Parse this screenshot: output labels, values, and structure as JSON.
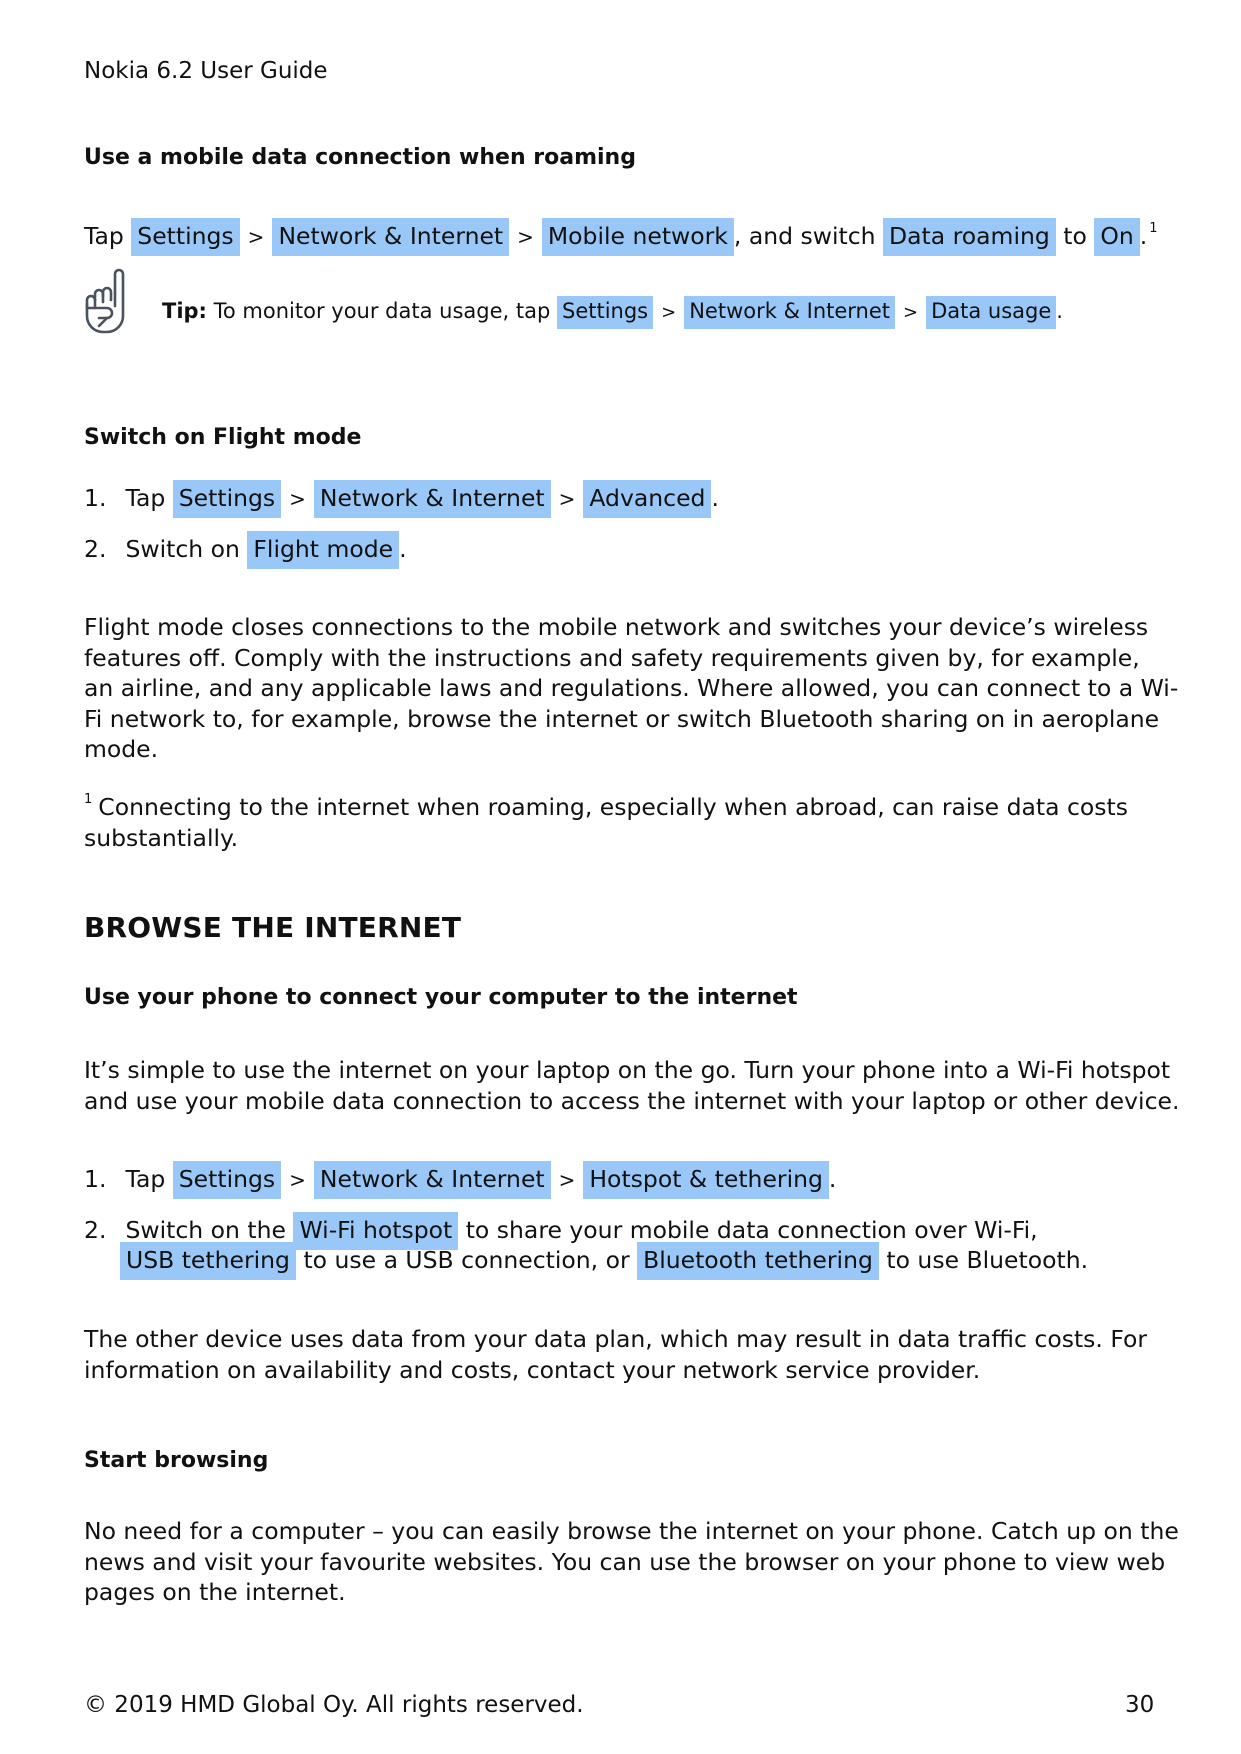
{
  "running_header": "Nokia 6.2 User Guide",
  "roaming": {
    "heading": "Use a mobile data connection when roaming",
    "instruction": {
      "prefix": "Tap",
      "path": [
        "Settings",
        "Network & Internet",
        "Mobile network"
      ],
      "middle": ", and switch",
      "toggle": "Data roaming",
      "to": "to",
      "state": "On",
      "suffix": ".",
      "footnote_ref": "1"
    },
    "tip": {
      "icon": "pointing-hand-icon",
      "label": "Tip:",
      "text": "To monitor your data usage, tap",
      "path": [
        "Settings",
        "Network & Internet",
        "Data usage"
      ],
      "suffix": "."
    }
  },
  "flight_mode": {
    "heading": "Switch on Flight mode",
    "steps": [
      {
        "number": "1.",
        "prefix": "Tap",
        "path": [
          "Settings",
          "Network & Internet",
          "Advanced"
        ],
        "suffix": "."
      },
      {
        "number": "2.",
        "prefix": "Switch on",
        "item": "Flight mode",
        "suffix": "."
      }
    ],
    "paragraph_lines": [
      "Flight mode closes connections to the mobile network and switches your device’s wireless",
      "features off.  Comply with the instructions and safety requirements given by, for example,",
      "an airline, and any applicable laws and regulations.  Where allowed, you can connect to a Wi-",
      "Fi network to, for example, browse the internet or switch Bluetooth sharing on in aeroplane",
      "mode."
    ],
    "footnote": {
      "marker": "1",
      "lines": [
        "Connecting to the internet when roaming, especially when abroad, can raise data costs",
        "substantially."
      ]
    }
  },
  "browse": {
    "heading": "BROWSE THE INTERNET",
    "connect": {
      "heading": "Use your phone to connect your computer to the internet",
      "paragraph_lines": [
        "It’s simple to use the internet on your laptop on the go.  Turn your phone into a Wi-Fi hotspot",
        "and use your mobile data connection to access the internet with your laptop or other device."
      ],
      "steps": [
        {
          "number": "1.",
          "prefix": "Tap",
          "path": [
            "Settings",
            "Network & Internet",
            "Hotspot & tethering"
          ],
          "suffix": "."
        },
        {
          "number": "2.",
          "prefix": "Switch on the",
          "item1": "Wi-Fi hotspot",
          "text1": "to share your mobile data connection over Wi-Fi,",
          "item2": "USB tethering",
          "text2": "to use a USB connection, or",
          "item3": "Bluetooth tethering",
          "text3": "to use Bluetooth."
        }
      ],
      "note_lines": [
        "The other device uses data from your data plan, which may result in data traffic costs.  For",
        "information on availability and costs, contact your network service provider."
      ]
    },
    "start": {
      "heading": "Start browsing",
      "paragraph_lines": [
        "No need for a computer – you can easily browse the internet on your phone.  Catch up on the",
        "news and visit your favourite websites.  You can use the browser on your phone to view web",
        "pages on the internet."
      ]
    }
  },
  "footer": {
    "copyright": "© 2019 HMD Global Oy.  All rights reserved.",
    "page_number": "30"
  },
  "colors": {
    "highlight": "#99c8f8",
    "text": "#111111",
    "icon_stroke": "#4a5260"
  }
}
